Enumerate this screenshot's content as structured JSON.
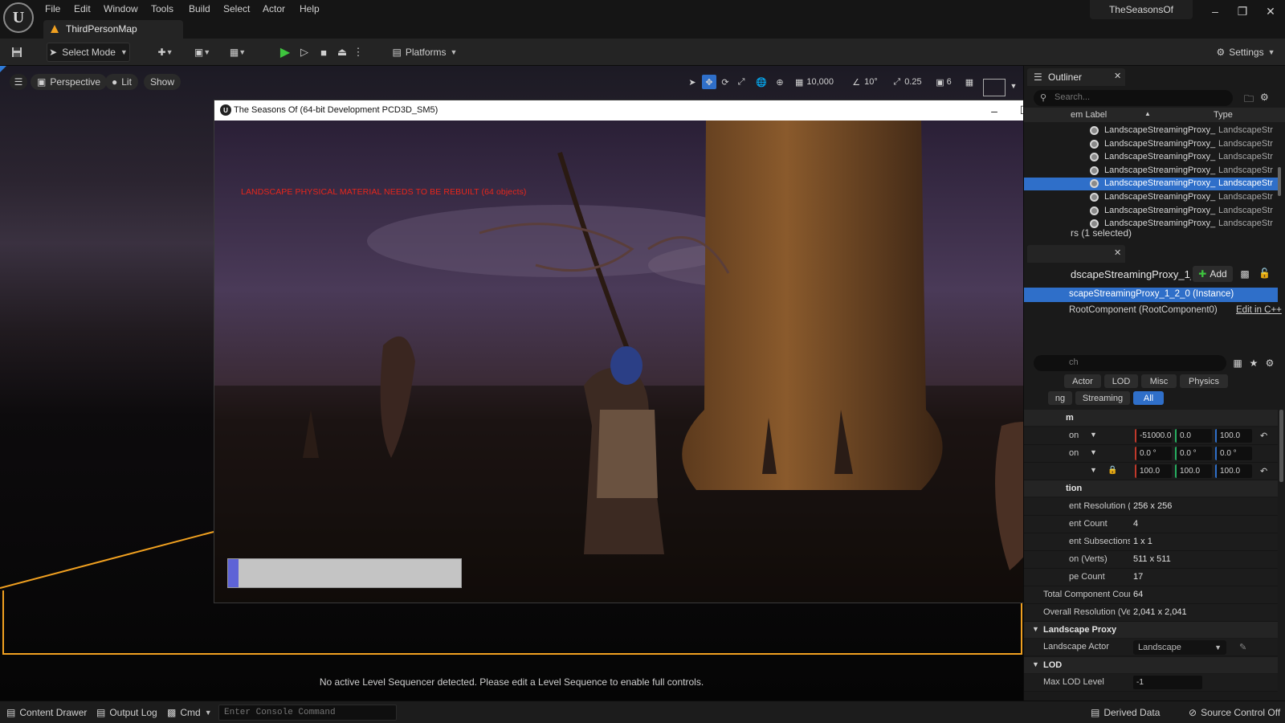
{
  "menu": {
    "items": [
      "File",
      "Edit",
      "Window",
      "Tools",
      "Build",
      "Select",
      "Actor",
      "Help"
    ]
  },
  "document_tab": {
    "label": "ThirdPersonMap",
    "icon": "warning-level-icon"
  },
  "project_name": "TheSeasonsOf",
  "toolbar": {
    "select_mode": "Select Mode",
    "platforms": "Platforms",
    "settings": "Settings"
  },
  "viewport": {
    "perspective": "Perspective",
    "lit": "Lit",
    "show": "Show",
    "grid_snap": "10,000",
    "rotation_snap": "10°",
    "scale_snap": "0.25",
    "camera_speed": "6",
    "sequencer_message": "No active Level Sequencer detected. Please edit a Level Sequence to enable full controls."
  },
  "game_window": {
    "title": "The Seasons Of (64-bit Development PCD3D_SM5)",
    "warning": "LANDSCAPE PHYSICAL MATERIAL NEEDS TO BE REBUILT (64 objects)",
    "loading_progress": 0.045
  },
  "outliner": {
    "tab_label": "Outliner",
    "search_placeholder": "Search...",
    "col_label": "em Label",
    "col_type": "Type",
    "rows": [
      {
        "label": "LandscapeStreamingProxy_",
        "type": "LandscapeStr",
        "selected": false
      },
      {
        "label": "LandscapeStreamingProxy_",
        "type": "LandscapeStr",
        "selected": false
      },
      {
        "label": "LandscapeStreamingProxy_",
        "type": "LandscapeStr",
        "selected": false
      },
      {
        "label": "LandscapeStreamingProxy_",
        "type": "LandscapeStr",
        "selected": false
      },
      {
        "label": "LandscapeStreamingProxy_",
        "type": "LandscapeStr",
        "selected": true
      },
      {
        "label": "LandscapeStreamingProxy_",
        "type": "LandscapeStr",
        "selected": false
      },
      {
        "label": "LandscapeStreamingProxy_",
        "type": "LandscapeStr",
        "selected": false
      },
      {
        "label": "LandscapeStreamingProxy_",
        "type": "LandscapeStr",
        "selected": false
      }
    ],
    "status": "rs (1 selected)"
  },
  "details": {
    "actor_name": "dscapeStreamingProxy_1_",
    "add_label": "Add",
    "instance_label": "scapeStreamingProxy_1_2_0 (Instance)",
    "root_label": "RootComponent (RootComponent0)",
    "edit_cpp": "Edit in C++",
    "search_placeholder": "ch",
    "filters_row1": [
      "Actor",
      "LOD",
      "Misc",
      "Physics"
    ],
    "filters_row2": [
      "ng",
      "Streaming",
      "All"
    ],
    "transform_header": "m",
    "transform": {
      "location_label": "on",
      "location": [
        "-51000.0",
        "0.0",
        "100.0"
      ],
      "rotation_label": "on",
      "rotation": [
        "0.0 °",
        "0.0 °",
        "0.0 °"
      ],
      "scale": [
        "100.0",
        "100.0",
        "100.0"
      ]
    },
    "info_header": "tion",
    "info_rows": [
      {
        "name": "ent Resolution (",
        "value": "256 x 256"
      },
      {
        "name": "ent Count",
        "value": "4"
      },
      {
        "name": "ent Subsections",
        "value": "1 x 1"
      },
      {
        "name": "on (Verts)",
        "value": "511 x 511"
      },
      {
        "name": "pe Count",
        "value": "17"
      },
      {
        "name": "Total Component Count",
        "value": "64"
      },
      {
        "name": "Overall Resolution (Vert",
        "value": "2,041 x 2,041"
      }
    ],
    "proxy_header": "Landscape Proxy",
    "landscape_actor_label": "Landscape Actor",
    "landscape_actor_value": "Landscape",
    "lod_header": "LOD",
    "max_lod_label": "Max LOD Level",
    "max_lod_value": "-1"
  },
  "statusbar": {
    "content_drawer": "Content Drawer",
    "output_log": "Output Log",
    "cmd": "Cmd",
    "console_placeholder": "Enter Console Command",
    "derived_data": "Derived Data",
    "source_control": "Source Control Off"
  },
  "colors": {
    "accent": "#2f6fc9",
    "warning_text": "#e8261b",
    "selection_outline": "#f0a020",
    "play_green": "#3ec43e"
  }
}
